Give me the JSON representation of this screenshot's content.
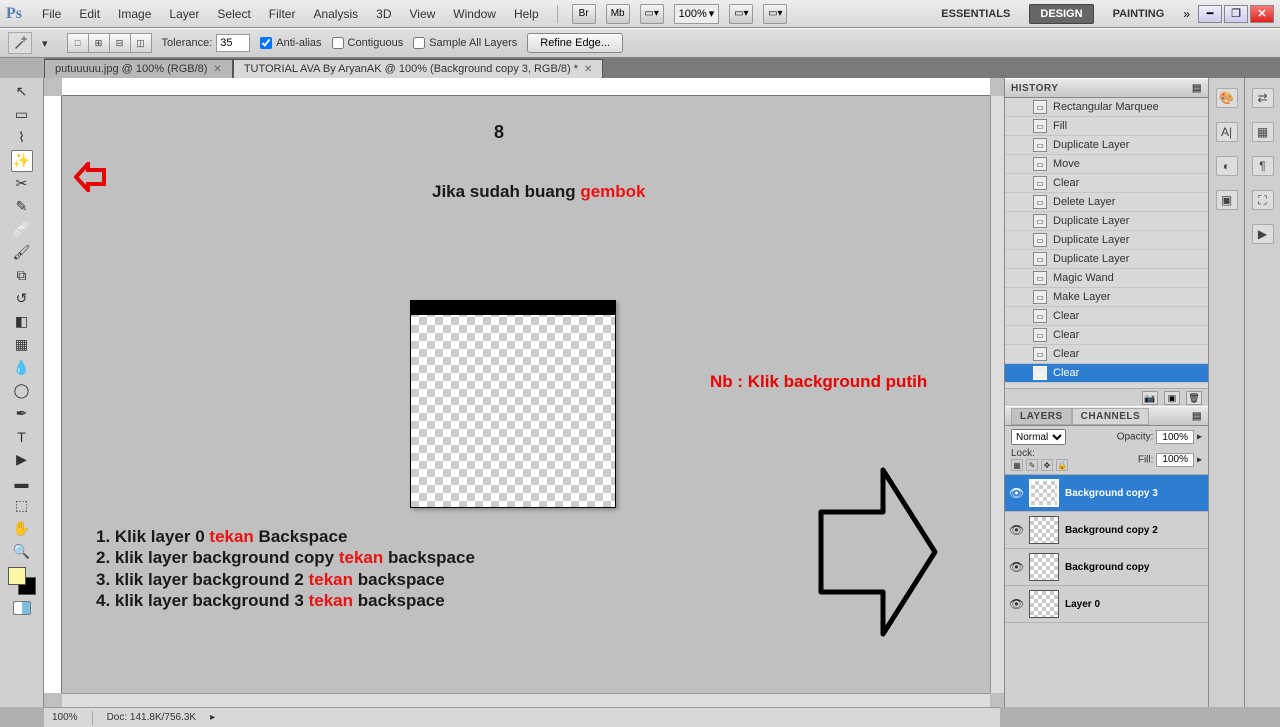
{
  "menu": {
    "items": [
      "File",
      "Edit",
      "Image",
      "Layer",
      "Select",
      "Filter",
      "Analysis",
      "3D",
      "View",
      "Window",
      "Help"
    ]
  },
  "zoom": "100%",
  "workspaces": {
    "essentials": "ESSENTIALS",
    "design": "DESIGN",
    "painting": "PAINTING"
  },
  "options": {
    "tolerance_label": "Tolerance:",
    "tolerance_value": "35",
    "antialias": "Anti-alias",
    "contiguous": "Contiguous",
    "sample_all": "Sample All Layers",
    "refine": "Refine Edge..."
  },
  "tabs": {
    "t1": "putuuuuu.jpg @ 100% (RGB/8)",
    "t2": "TUTORIAL AVA By AryanAK @ 100% (Background copy 3, RGB/8) *"
  },
  "canvas": {
    "page": "8",
    "line1a": "Jika sudah buang ",
    "line1b": "gembok",
    "nb": "Nb : Klik background putih",
    "step1a": "1. Klik layer 0 ",
    "step1b": "tekan",
    "step1c": " Backspace",
    "step2a": "2. klik layer background copy ",
    "step2b": "tekan",
    "step2c": " backspace",
    "step3a": "3. klik layer background 2 ",
    "step3b": "tekan",
    "step3c": " backspace",
    "step4a": "4. klik layer background 3 ",
    "step4b": "tekan",
    "step4c": " backspace"
  },
  "history": {
    "title": "HISTORY",
    "items": [
      "Rectangular Marquee",
      "Fill",
      "Duplicate Layer",
      "Move",
      "Clear",
      "Delete Layer",
      "Duplicate Layer",
      "Duplicate Layer",
      "Duplicate Layer",
      "Magic Wand",
      "Make Layer",
      "Clear",
      "Clear",
      "Clear",
      "Clear"
    ],
    "selected_index": 14
  },
  "layers": {
    "tab1": "LAYERS",
    "tab2": "CHANNELS",
    "blend": "Normal",
    "opacity_label": "Opacity:",
    "opacity": "100%",
    "lock_label": "Lock:",
    "fill_label": "Fill:",
    "fill": "100%",
    "items": [
      {
        "name": "Background copy 3"
      },
      {
        "name": "Background copy 2"
      },
      {
        "name": "Background copy"
      },
      {
        "name": "Layer 0"
      }
    ]
  },
  "status": {
    "zoom": "100%",
    "doc": "Doc: 141.8K/756.3K"
  }
}
